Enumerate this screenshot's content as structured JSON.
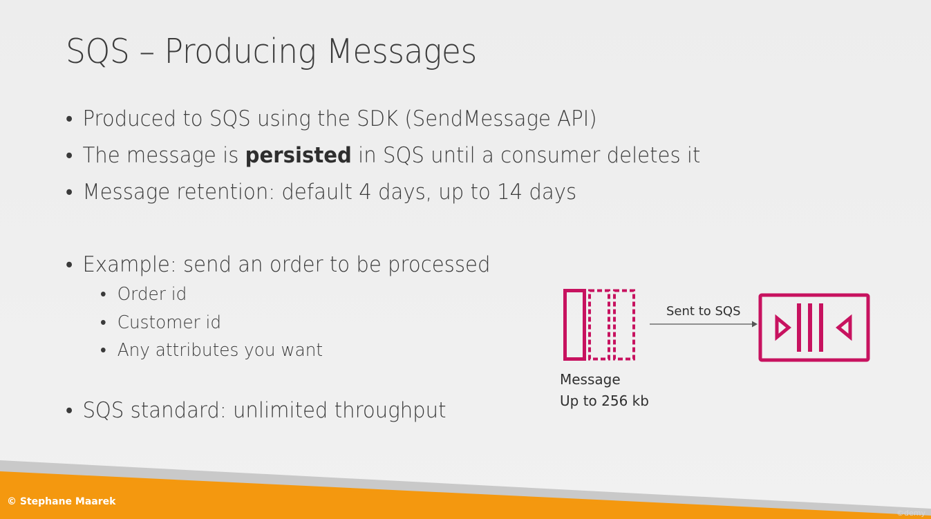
{
  "slide": {
    "title": "SQS – Producing Messages",
    "bullets": [
      {
        "text": "Produced to SQS using the SDK (SendMessage API)"
      },
      {
        "pre": "The message is ",
        "bold": "persisted",
        "post": " in SQS until a consumer deletes it"
      },
      {
        "text": "Message retention: default 4 days, up to 14 days"
      },
      {
        "text": "Example: send an order to be processed"
      },
      {
        "text": "SQS standard: unlimited throughput"
      }
    ],
    "sub_bullets": [
      "Order id",
      "Customer id",
      "Any attributes you want"
    ],
    "bullet_glyph": "•"
  },
  "diagram": {
    "message_label_1": "Message",
    "message_label_2": "Up to 256 kb",
    "arrow_label": "Sent to SQS",
    "accent_color": "#c7125f",
    "message_icon": "message-icon",
    "queue_icon": "sqs-queue-icon",
    "arrow_icon": "arrow-right-icon"
  },
  "footer": {
    "copyright": "© Stephane Maarek",
    "watermark": "©demy",
    "band_color": "#f4980f"
  }
}
